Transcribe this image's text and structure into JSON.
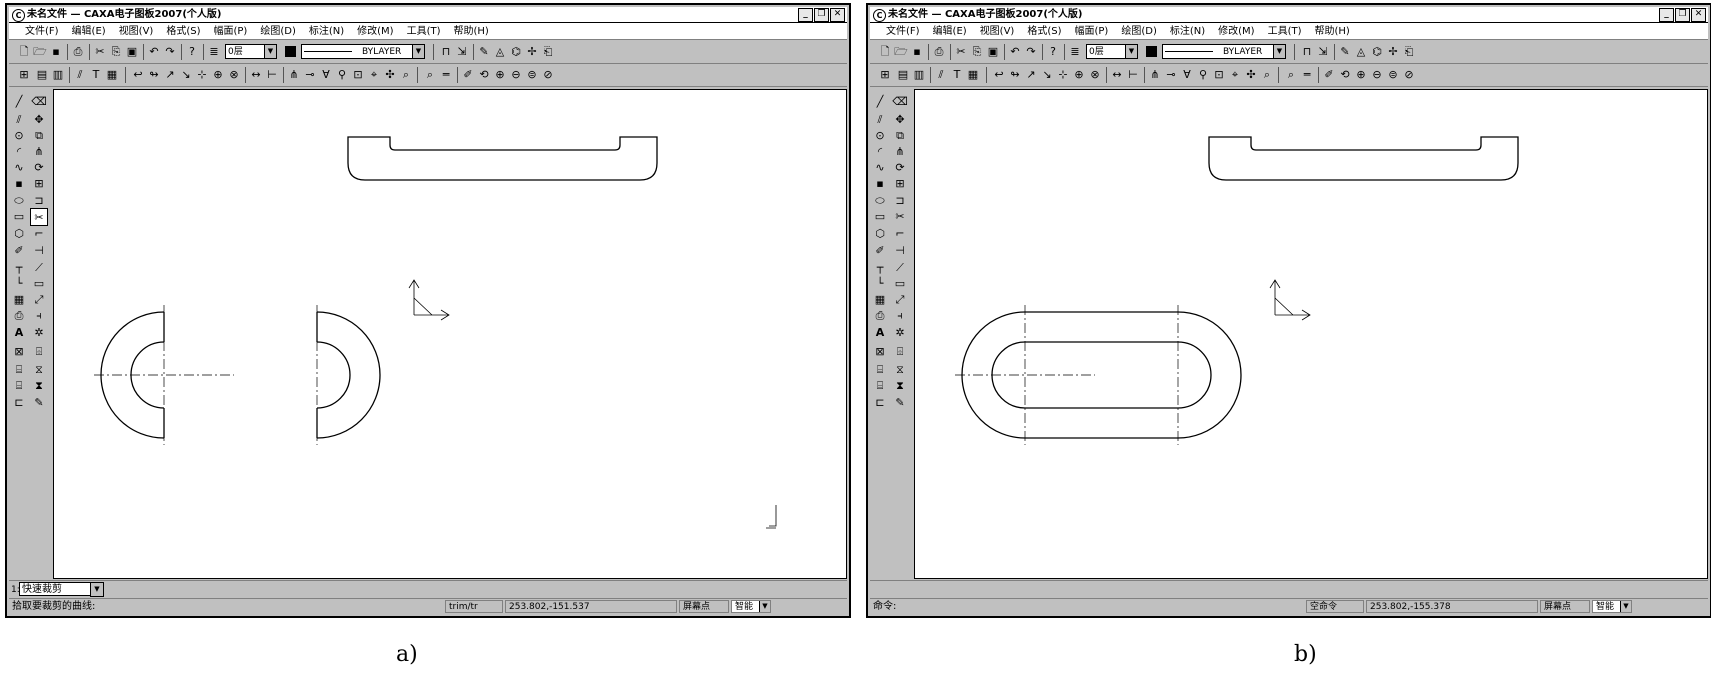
{
  "windows": [
    {
      "title": "未名文件  — CAXA电子图板2007(个人版)",
      "menu": [
        "文件(F)",
        "编辑(E)",
        "视图(V)",
        "格式(S)",
        "幅面(P)",
        "绘图(D)",
        "标注(N)",
        "修改(M)",
        "工具(T)",
        "帮助(H)"
      ],
      "layer": "0层",
      "linetype": "BYLAYER",
      "cmd_number": "1:",
      "cmd_mode": "快速裁剪",
      "prompt": "拾取要裁剪的曲线:",
      "command": "trim/tr",
      "coords": "253.802,-151.537",
      "snap": "屏幕点",
      "smart": "智能",
      "caption": "a)"
    },
    {
      "title": "未名文件  — CAXA电子图板2007(个人版)",
      "menu": [
        "文件(F)",
        "编辑(E)",
        "视图(V)",
        "格式(S)",
        "幅面(P)",
        "绘图(D)",
        "标注(N)",
        "修改(M)",
        "工具(T)",
        "帮助(H)"
      ],
      "layer": "0层",
      "linetype": "BYLAYER",
      "prompt": "命令:",
      "command": "空命令",
      "coords": "253.802,-155.378",
      "snap": "屏幕点",
      "smart": "智能",
      "caption": "b)"
    }
  ],
  "icons": {
    "window_buttons": [
      "minimize-icon",
      "restore-icon",
      "close-icon"
    ],
    "left_tools": [
      "line-icon",
      "parallel-icon",
      "circle-icon",
      "arc-icon",
      "spline-icon",
      "point-icon",
      "ellipse-icon",
      "rectangle-icon",
      "polygon-icon",
      "polyline-icon",
      "center-line-icon",
      "hatch-icon",
      "text-icon"
    ]
  }
}
